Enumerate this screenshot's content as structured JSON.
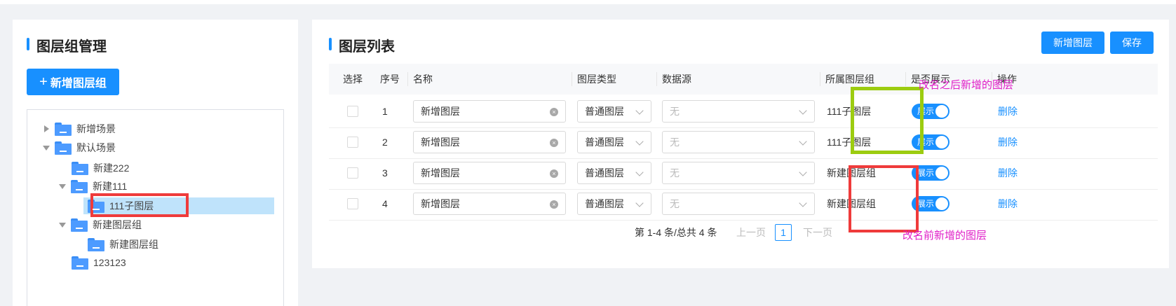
{
  "left": {
    "title": "图层组管理",
    "add_button": "新增图层组",
    "add_icon": "+",
    "tree": [
      {
        "label": "新增场景",
        "level": 0,
        "expanded": false
      },
      {
        "label": "默认场景",
        "level": 0,
        "expanded": true
      },
      {
        "label": "新建222",
        "level": 1
      },
      {
        "label": "新建111",
        "level": 1,
        "expanded": true
      },
      {
        "label": "111子图层",
        "level": 2,
        "selected": true
      },
      {
        "label": "新建图层组",
        "level": 1,
        "expanded": true
      },
      {
        "label": "新建图层组",
        "level": 2
      },
      {
        "label": "123123",
        "level": 1
      }
    ]
  },
  "right": {
    "title": "图层列表",
    "new_layer_button": "新增图层",
    "save_button": "保存",
    "columns": [
      "选择",
      "序号",
      "名称",
      "图层类型",
      "数据源",
      "所属图层组",
      "是否展示",
      "操作"
    ],
    "rows": [
      {
        "index": "1",
        "name": "新增图层",
        "type": "普通图层",
        "source": "无",
        "group": "111子图层",
        "show": "展示",
        "action": "删除"
      },
      {
        "index": "2",
        "name": "新增图层",
        "type": "普通图层",
        "source": "无",
        "group": "111子图层",
        "show": "展示",
        "action": "删除"
      },
      {
        "index": "3",
        "name": "新增图层",
        "type": "普通图层",
        "source": "无",
        "group": "新建图层组",
        "show": "展示",
        "action": "删除"
      },
      {
        "index": "4",
        "name": "新增图层",
        "type": "普通图层",
        "source": "无",
        "group": "新建图层组",
        "show": "展示",
        "action": "删除"
      }
    ],
    "pagination": {
      "summary": "第 1-4 条/总共 4 条",
      "prev": "上一页",
      "current": "1",
      "next": "下一页"
    }
  },
  "annotations": {
    "top": "改名之后新增的图层",
    "bottom": "改名前新增的图层",
    "annotation_color": "#e020c8",
    "green_box_color": "#9ccc10",
    "red_box_color": "#ef3b3b"
  },
  "colors": {
    "accent": "#1890ff"
  }
}
